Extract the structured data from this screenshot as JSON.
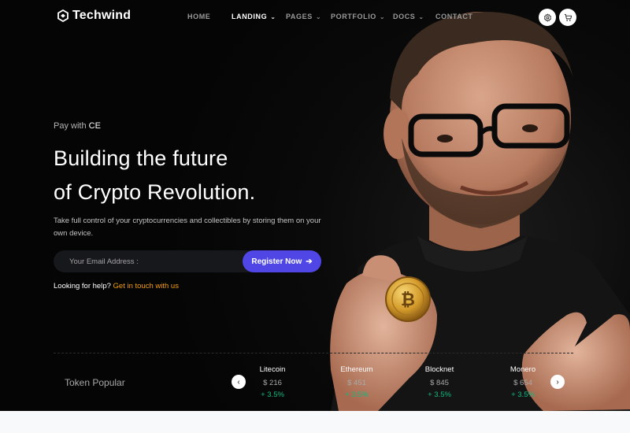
{
  "brand": {
    "name": "Techwind",
    "logo_icon": "techwind-logo-icon"
  },
  "nav": {
    "items": [
      {
        "label": "HOME",
        "has_dropdown": false,
        "active": false
      },
      {
        "label": "LANDING",
        "has_dropdown": true,
        "active": true
      },
      {
        "label": "PAGES",
        "has_dropdown": true,
        "active": false
      },
      {
        "label": "PORTFOLIO",
        "has_dropdown": true,
        "active": false
      },
      {
        "label": "DOCS",
        "has_dropdown": true,
        "active": false
      },
      {
        "label": "CONTACT",
        "has_dropdown": false,
        "active": false
      }
    ],
    "buttons": [
      {
        "icon": "gear-icon"
      },
      {
        "icon": "cart-icon"
      }
    ]
  },
  "hero": {
    "eyebrow_prefix": "Pay with",
    "eyebrow_highlight": "CE",
    "title_line1": "Building the future",
    "title_line2": "of Crypto Revolution.",
    "subtitle": "Take full control of your cryptocurrencies and collectibles by storing them on your own device.",
    "email_placeholder": "Your Email Address :",
    "register_label": "Register Now",
    "register_icon": "arrow-right-icon",
    "help_text": "Looking for help?",
    "help_link": "Get in touch with us"
  },
  "tokens": {
    "title": "Token Popular",
    "items": [
      {
        "name": "Litecoin",
        "price": "$ 216",
        "change": "+ 3.5%"
      },
      {
        "name": "Ethereum",
        "price": "$ 451",
        "change": "+ 3.5%"
      },
      {
        "name": "Blocknet",
        "price": "$ 845",
        "change": "+ 3.5%"
      },
      {
        "name": "Monero",
        "price": "$ 654",
        "change": "+ 3.5%"
      }
    ],
    "prev_icon": "chevron-left-icon",
    "next_icon": "chevron-right-icon"
  },
  "colors": {
    "accent": "#4f46e5",
    "link": "#f59e0b",
    "positive": "#10b981",
    "background": "#050505"
  }
}
